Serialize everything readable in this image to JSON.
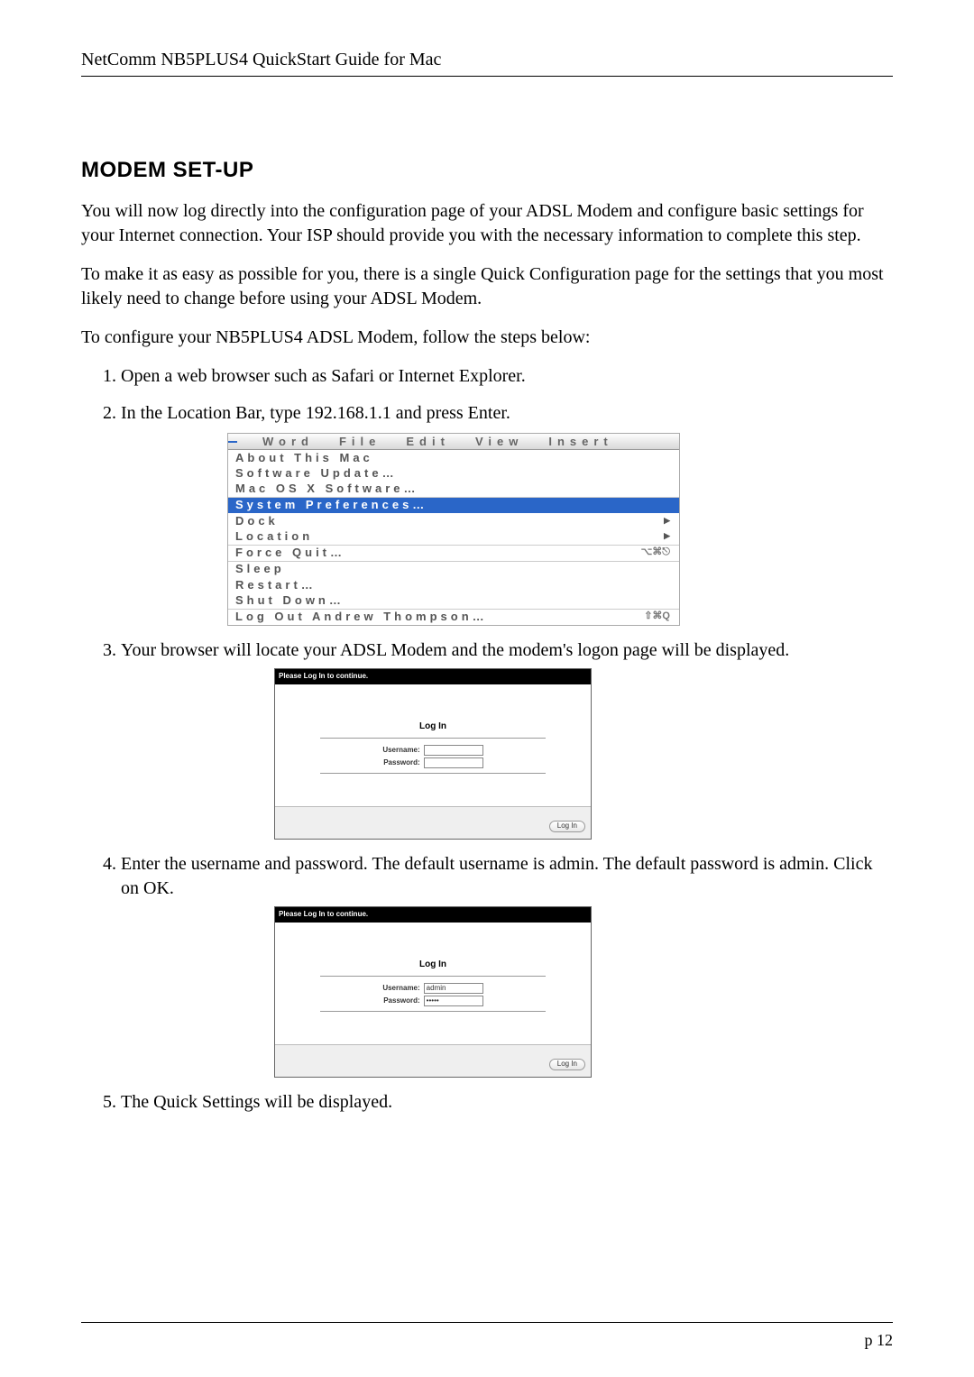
{
  "header": "NetComm NB5PLUS4 QuickStart Guide for Mac",
  "section_title": "MODEM SET-UP",
  "para1": "You will now log directly into the configuration page of your ADSL Modem and configure basic settings for your Internet connection. Your ISP should provide you with the necessary information to complete this step.",
  "para2": "To make it as easy as possible for you, there is a single Quick Configuration page for the settings that you most likely need to change before using your ADSL Modem.",
  "para3": "To configure your  NB5PLUS4 ADSL Modem, follow the steps below:",
  "steps": {
    "s1": "Open a web browser such as Safari or Internet Explorer.",
    "s2": "In the Location Bar, type 192.168.1.1 and press Enter.",
    "s3": "Your browser will locate your ADSL Modem and the modem's logon page will be displayed.",
    "s4": "Enter the username and password. The default username is admin. The default password is admin. Click on OK.",
    "s5": "The Quick Settings will be displayed."
  },
  "apple_menu": {
    "menubar": {
      "m1": "Word",
      "m2": "File",
      "m3": "Edit",
      "m4": "View",
      "m5": "Insert"
    },
    "items": {
      "about": "About This Mac",
      "swupdate": "Software Update…",
      "macosx": "Mac OS X Software…",
      "sysprefs": "System Preferences…",
      "dock": "Dock",
      "location": "Location",
      "forcequit": "Force Quit…",
      "fq_shortcut": "⌥⌘⎋",
      "sleep": "Sleep",
      "restart": "Restart…",
      "shutdown": "Shut Down…",
      "logout": "Log Out Andrew Thompson…",
      "logout_shortcut": "⇧⌘Q"
    }
  },
  "login_box": {
    "titlebar": "Please Log In to continue.",
    "heading": "Log In",
    "user_label": "Username:",
    "pass_label": "Password:",
    "button": "Log In"
  },
  "login_box_filled": {
    "user_value": "admin",
    "pass_value": "•••••"
  },
  "page_number": "p 12"
}
